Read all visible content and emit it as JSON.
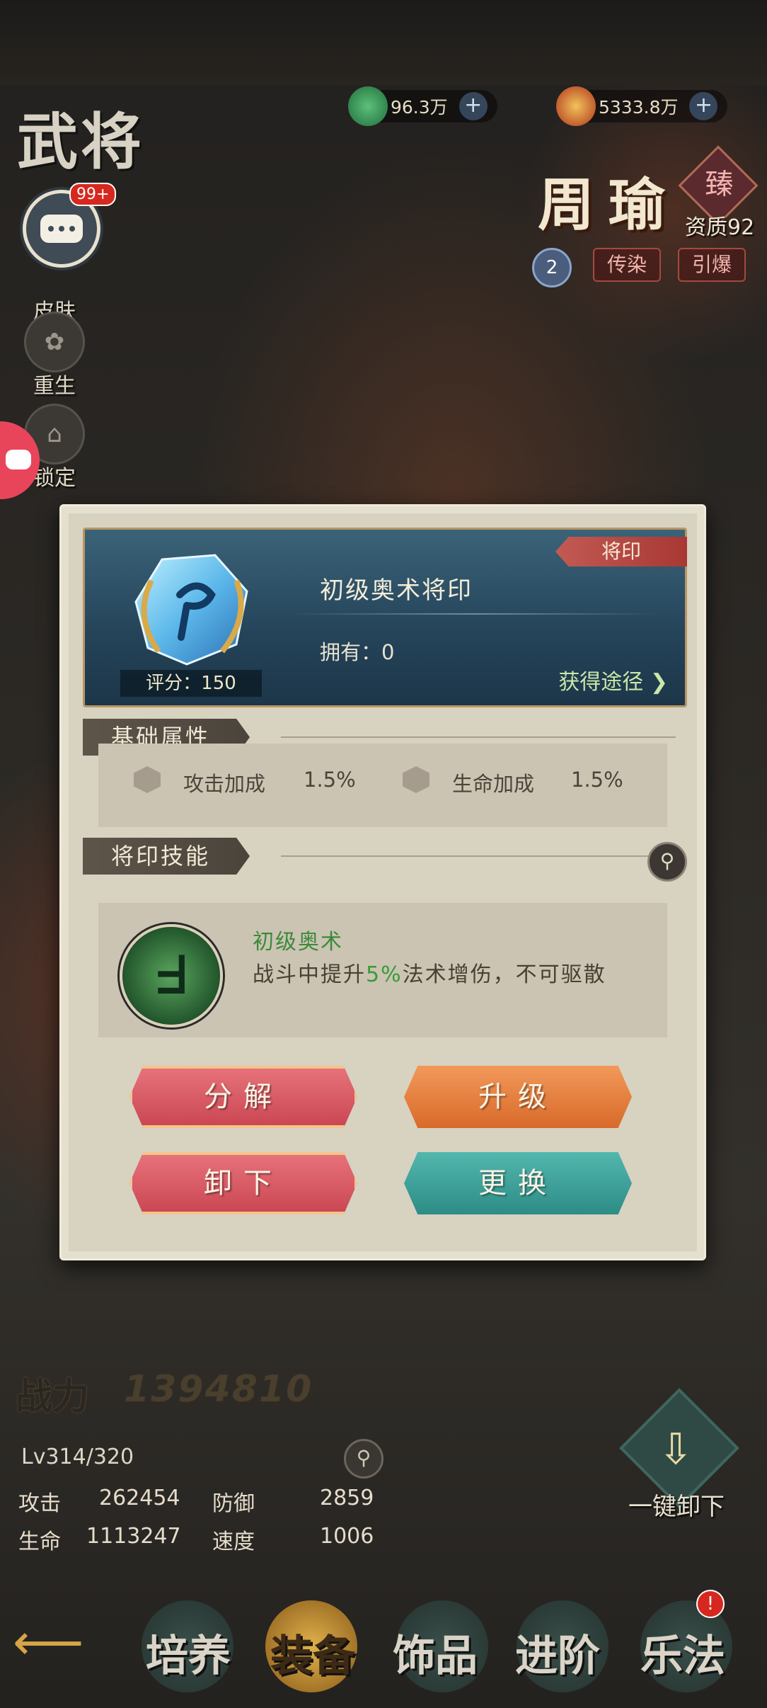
{
  "header": {
    "page_title": "武将",
    "currency": [
      {
        "icon": "jade-coin-icon",
        "value": "96.3万"
      },
      {
        "icon": "gold-coin-icon",
        "value": "5333.8万"
      }
    ]
  },
  "side_menu": {
    "chat_badge": "99+",
    "items": [
      {
        "label": "皮肤",
        "icon": "skin-icon"
      },
      {
        "label": "重生",
        "icon": "lotus-icon"
      },
      {
        "label": "锁定",
        "icon": "lock-icon"
      }
    ]
  },
  "hero": {
    "name": "周瑜",
    "rarity": "臻",
    "quality": "资质92",
    "star_level": "2",
    "tags": [
      "传染",
      "引爆"
    ]
  },
  "dialog": {
    "category_tag": "将印",
    "item_name": "初级奥术将印",
    "owned_label": "拥有：0",
    "score_label": "评分：150",
    "obtain_label": "获得途径",
    "base_attr_title": "基础属性",
    "attrs": [
      {
        "name": "攻击加成",
        "value": "1.5%"
      },
      {
        "name": "生命加成",
        "value": "1.5%"
      }
    ],
    "skill_title": "将印技能",
    "skill_name": "初级奥术",
    "skill_desc_pre": "战斗中提升",
    "skill_desc_hl": "5%",
    "skill_desc_post": "法术增伤，不可驱散",
    "buttons": {
      "decompose": "分解",
      "upgrade": "升级",
      "unequip": "卸下",
      "replace": "更换"
    }
  },
  "stats": {
    "power_label": "战力",
    "power_value": "1394810",
    "level": "Lv314/320",
    "attack_label": "攻击",
    "attack_value": "262454",
    "defense_label": "防御",
    "defense_value": "2859",
    "hp_label": "生命",
    "hp_value": "1113247",
    "speed_label": "速度",
    "speed_value": "1006",
    "unequip_all_label": "一键卸下"
  },
  "bottom_nav": [
    "培养",
    "装备",
    "饰品",
    "进阶",
    "乐法"
  ],
  "bottom_nav_badge": "!"
}
